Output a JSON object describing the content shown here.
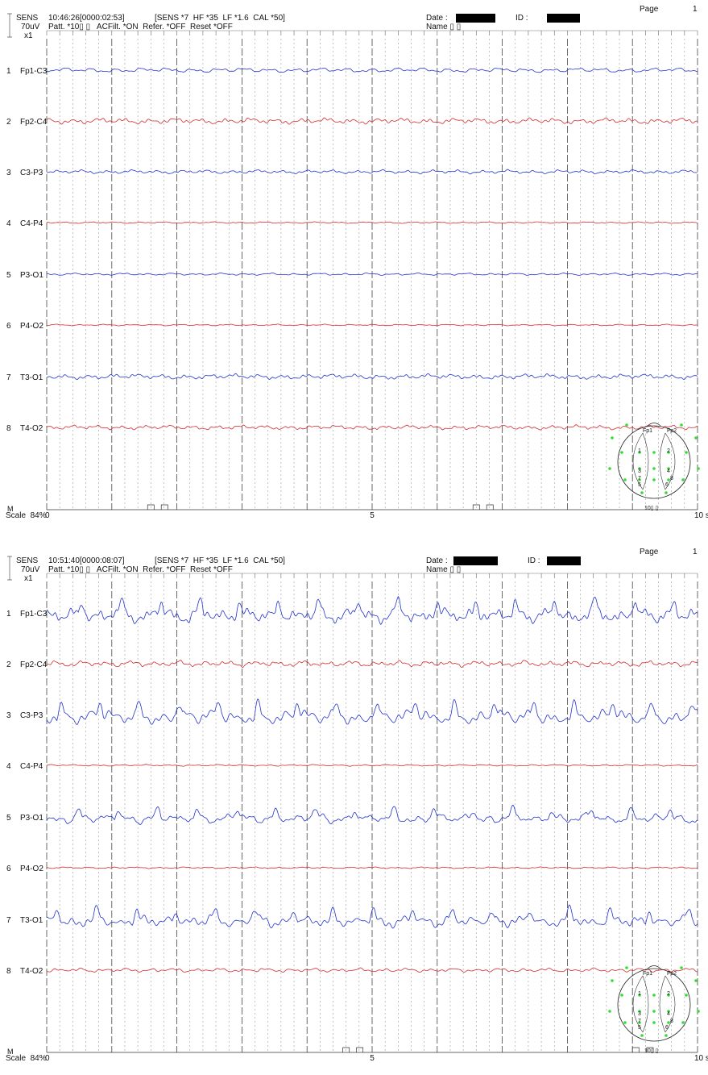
{
  "pages": [
    {
      "page_label": "Page",
      "page_number": "1",
      "sens_label": "SENS",
      "sens_value": "70uV",
      "sens_mult": "x1",
      "time_text": "10:46:26[0000:02:53]",
      "settings_text": "[SENS *7  HF *35  LF *1.6  CAL *50]",
      "patt_text": "Patt. *10▯ ▯   ACFilt. *ON  Refer. *OFF  Reset *OFF",
      "date_label": "Date :",
      "id_label": "ID :",
      "name_label": "Name ▯ ▯",
      "scale_text": "Scale  84%",
      "marker_m": "M",
      "montage_label": "10▯ ▯",
      "head_labels": [
        "Fp1",
        "Fp2",
        "1",
        "2",
        "3",
        "4",
        "7",
        "8",
        "5",
        "6"
      ]
    },
    {
      "page_label": "Page",
      "page_number": "1",
      "sens_label": "SENS",
      "sens_value": "70uV",
      "sens_mult": "x1",
      "time_text": "10:51:40[0000:08:07]",
      "settings_text": "[SENS *7  HF *35  LF *1.6  CAL *50]",
      "patt_text": "Patt. *10▯ ▯   ACFilt. *ON  Refer. *OFF  Reset *OFF",
      "date_label": "Date :",
      "id_label": "ID :",
      "name_label": "Name ▯ ▯",
      "scale_text": "Scale  84%",
      "marker_m": "M",
      "montage_label": "10▯ ▯",
      "head_labels": [
        "Fp1",
        "Fp2",
        "1",
        "2",
        "3",
        "4",
        "7",
        "8",
        "5",
        "6"
      ]
    }
  ],
  "chart_data": [
    {
      "type": "line",
      "x_unit": "s",
      "xlim": [
        0,
        10
      ],
      "x_tick_labels": [
        "0",
        "5",
        "10 s"
      ],
      "channels": [
        {
          "index": "1",
          "name": "Fp1-C3",
          "color": "#2233cc",
          "amplitude": 0.35
        },
        {
          "index": "2",
          "name": "Fp2-C4",
          "color": "#d42a2a",
          "amplitude": 0.45
        },
        {
          "index": "3",
          "name": "C3-P3",
          "color": "#2233cc",
          "amplitude": 0.3
        },
        {
          "index": "4",
          "name": "C4-P4",
          "color": "#d42a2a",
          "amplitude": 0.12
        },
        {
          "index": "5",
          "name": "P3-O1",
          "color": "#2233cc",
          "amplitude": 0.18
        },
        {
          "index": "6",
          "name": "P4-O2",
          "color": "#d42a2a",
          "amplitude": 0.12
        },
        {
          "index": "7",
          "name": "T3-O1",
          "color": "#2233cc",
          "amplitude": 0.4
        },
        {
          "index": "8",
          "name": "T4-O2",
          "color": "#d42a2a",
          "amplitude": 0.35
        }
      ]
    },
    {
      "type": "line",
      "x_unit": "s",
      "xlim": [
        0,
        10
      ],
      "x_tick_labels": [
        "0",
        "5",
        "10 s"
      ],
      "channels": [
        {
          "index": "1",
          "name": "Fp1-C3",
          "color": "#2233cc",
          "amplitude": 1.0
        },
        {
          "index": "2",
          "name": "Fp2-C4",
          "color": "#d42a2a",
          "amplitude": 0.45
        },
        {
          "index": "3",
          "name": "C3-P3",
          "color": "#2233cc",
          "amplitude": 1.0
        },
        {
          "index": "4",
          "name": "C4-P4",
          "color": "#d42a2a",
          "amplitude": 0.12
        },
        {
          "index": "5",
          "name": "P3-O1",
          "color": "#2233cc",
          "amplitude": 0.65
        },
        {
          "index": "6",
          "name": "P4-O2",
          "color": "#d42a2a",
          "amplitude": 0.12
        },
        {
          "index": "7",
          "name": "T3-O1",
          "color": "#2233cc",
          "amplitude": 0.8
        },
        {
          "index": "8",
          "name": "T4-O2",
          "color": "#d42a2a",
          "amplitude": 0.3
        }
      ]
    }
  ]
}
